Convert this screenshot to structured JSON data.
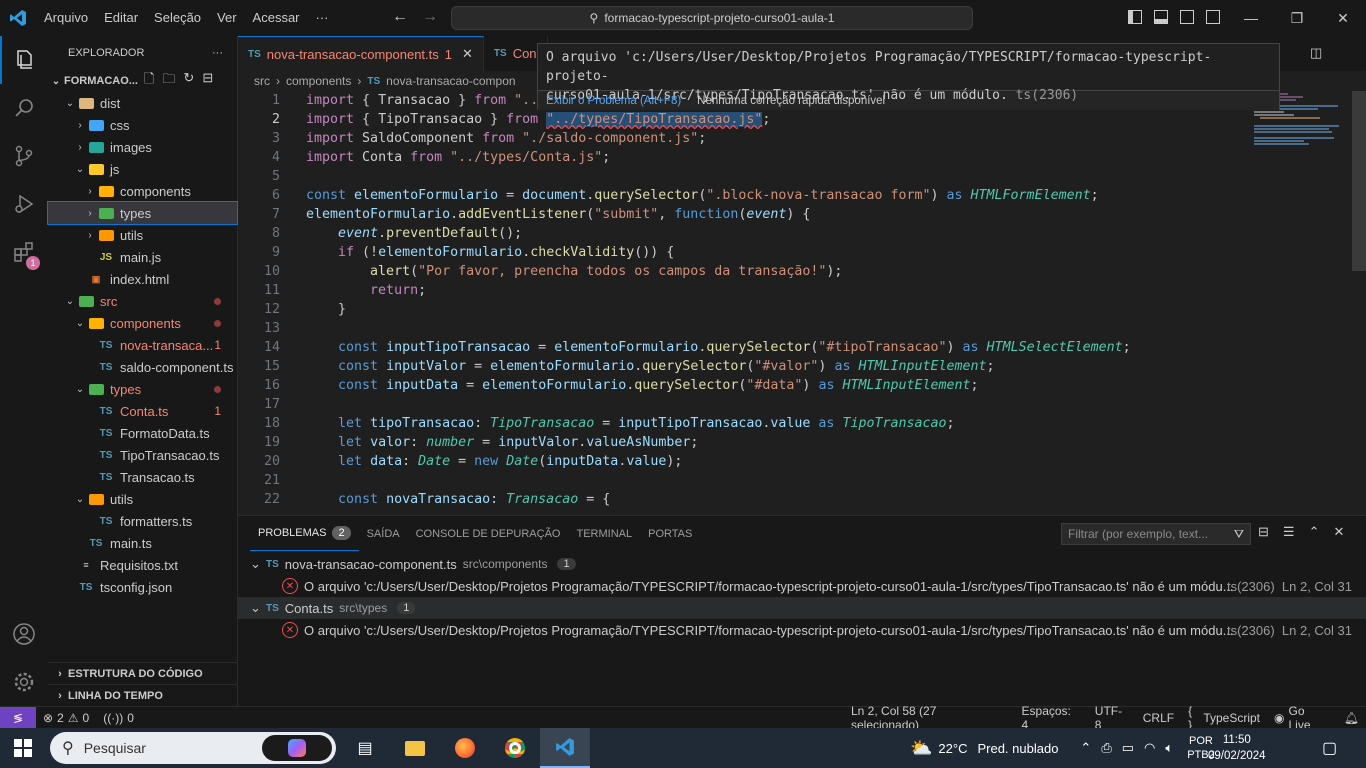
{
  "titlebar": {
    "menu": [
      "Arquivo",
      "Editar",
      "Seleção",
      "Ver",
      "Acessar",
      "···"
    ],
    "search_text": "formacao-typescript-projeto-curso01-aula-1"
  },
  "sidebar": {
    "header": "EXPLORADOR",
    "root": "FORMACAO...",
    "items": [
      {
        "label": "dist"
      },
      {
        "label": "css"
      },
      {
        "label": "images"
      },
      {
        "label": "js"
      },
      {
        "label": "components"
      },
      {
        "label": "types"
      },
      {
        "label": "utils"
      },
      {
        "label": "main.js"
      },
      {
        "label": "index.html"
      },
      {
        "label": "src"
      },
      {
        "label": "components"
      },
      {
        "label": "nova-transaca...",
        "count": "1"
      },
      {
        "label": "saldo-component.ts"
      },
      {
        "label": "types"
      },
      {
        "label": "Conta.ts",
        "count": "1"
      },
      {
        "label": "FormatoData.ts"
      },
      {
        "label": "TipoTransacao.ts"
      },
      {
        "label": "Transacao.ts"
      },
      {
        "label": "utils"
      },
      {
        "label": "formatters.ts"
      },
      {
        "label": "main.ts"
      },
      {
        "label": "Requisitos.txt"
      },
      {
        "label": "tsconfig.json"
      }
    ],
    "outline": "ESTRUTURA DO CÓDIGO",
    "timeline": "LINHA DO TEMPO"
  },
  "tabs": {
    "active": {
      "icon": "TS",
      "label": "nova-transacao-component.ts",
      "count": "1"
    },
    "second": {
      "icon": "TS",
      "label": "Con"
    }
  },
  "breadcrumb": [
    "src",
    "components",
    "nova-transacao-compon"
  ],
  "hover": {
    "message_line1": "O arquivo 'c:/Users/User/Desktop/Projetos Programação/TYPESCRIPT/formacao-typescript-projeto-",
    "message_line2": "curso01-aula-1/src/types/TipoTransacao.ts' não é um módulo.",
    "code": "ts(2306)",
    "action_link": "Exibir o Problema (Alt+F8)",
    "action_text": "Nenhuma correção rápida disponível"
  },
  "code": {
    "line_numbers": [
      "1",
      "2",
      "3",
      "4",
      "5",
      "6",
      "7",
      "8",
      "9",
      "10",
      "11",
      "12",
      "13",
      "14",
      "15",
      "16",
      "17",
      "18",
      "19",
      "20",
      "21",
      "22"
    ],
    "l1_kw": "import",
    "l1_a": " { Transacao } ",
    "l1_from": "from",
    "l1_str": " \"../",
    "l2_kw": "import",
    "l2_a": " { TipoTransacao } ",
    "l2_from": "from",
    "l2_str": "\"../types/TipoTransacao.js\"",
    "l2_end": ";",
    "l3_kw": "import",
    "l3_a": " SaldoComponent ",
    "l3_from": "from",
    "l3_str": " \"./saldo-component.js\"",
    "l3_end": ";",
    "l4_kw": "import",
    "l4_a": " Conta ",
    "l4_from": "from",
    "l4_str": " \"../types/Conta.js\"",
    "l4_end": ";",
    "l6_const": "const",
    "l6_var": " elementoFormulario",
    "l6_eq": " = ",
    "l6_doc": "document",
    "l6_dot": ".",
    "l6_fn": "querySelector",
    "l6_p": "(",
    "l6_str": "\".block-nova-transacao form\"",
    "l6_p2": ") ",
    "l6_as": "as",
    "l6_typ": " HTMLFormElement",
    "l6_end": ";",
    "l7_var": "elementoFormulario",
    "l7_dot": ".",
    "l7_fn": "addEventListener",
    "l7_p": "(",
    "l7_str": "\"submit\"",
    "l7_c": ", ",
    "l7_func": "function",
    "l7_p2": "(",
    "l7_ev": "event",
    "l7_p3": ") {",
    "l8_ev": "event",
    "l8_dot": ".",
    "l8_fn": "preventDefault",
    "l8_end": "();",
    "l9_if": "if",
    "l9_p": " (!",
    "l9_var": "elementoFormulario",
    "l9_dot": ".",
    "l9_fn": "checkValidity",
    "l9_end": "()) {",
    "l10_fn": "alert",
    "l10_p": "(",
    "l10_str": "\"Por favor, preencha todos os campos da transação!\"",
    "l10_end": ");",
    "l11_ret": "return",
    "l11_end": ";",
    "l12": "}",
    "l14_const": "const",
    "l14_var": " inputTipoTransacao",
    "l14_eq": " = ",
    "l14_v2": "elementoFormulario",
    "l14_dot": ".",
    "l14_fn": "querySelector",
    "l14_p": "(",
    "l14_str": "\"#tipoTransacao\"",
    "l14_p2": ") ",
    "l14_as": "as",
    "l14_typ": " HTMLSelectElement",
    "l14_end": ";",
    "l15_const": "const",
    "l15_var": " inputValor",
    "l15_eq": " = ",
    "l15_v2": "elementoFormulario",
    "l15_dot": ".",
    "l15_fn": "querySelector",
    "l15_p": "(",
    "l15_str": "\"#valor\"",
    "l15_p2": ") ",
    "l15_as": "as",
    "l15_typ": " HTMLInputElement",
    "l15_end": ";",
    "l16_const": "const",
    "l16_var": " inputData",
    "l16_eq": " = ",
    "l16_v2": "elementoFormulario",
    "l16_dot": ".",
    "l16_fn": "querySelector",
    "l16_p": "(",
    "l16_str": "\"#data\"",
    "l16_p2": ") ",
    "l16_as": "as",
    "l16_typ": " HTMLInputElement",
    "l16_end": ";",
    "l18_let": "let",
    "l18_var": " tipoTransacao",
    "l18_c": ": ",
    "l18_typ": "TipoTransacao",
    "l18_eq": " = ",
    "l18_v2": "inputTipoTransacao",
    "l18_dot": ".",
    "l18_v3": "value",
    "l18_as": " as",
    "l18_typ2": " TipoTransacao",
    "l18_end": ";",
    "l19_let": "let",
    "l19_var": " valor",
    "l19_c": ": ",
    "l19_typ": "number",
    "l19_eq": " = ",
    "l19_v2": "inputValor",
    "l19_dot": ".",
    "l19_v3": "valueAsNumber",
    "l19_end": ";",
    "l20_let": "let",
    "l20_var": " data",
    "l20_c": ": ",
    "l20_typ": "Date",
    "l20_eq": " = ",
    "l20_new": "new",
    "l20_typ2": " Date",
    "l20_p": "(",
    "l20_v2": "inputData",
    "l20_dot": ".",
    "l20_v3": "value",
    "l20_end": ");",
    "l22_const": "const",
    "l22_var": " novaTransacao",
    "l22_c": ": ",
    "l22_typ": "Transacao",
    "l22_end": " = {"
  },
  "panel": {
    "tabs": [
      "PROBLEMAS",
      "SAÍDA",
      "CONSOLE DE DEPURAÇÃO",
      "TERMINAL",
      "PORTAS"
    ],
    "problems_count": "2",
    "filter_placeholder": "Filtrar (por exemplo, text...",
    "groups": [
      {
        "icon": "TS",
        "file": "nova-transacao-component.ts",
        "path": "src\\components",
        "count": "1",
        "error": "O arquivo 'c:/Users/User/Desktop/Projetos Programação/TYPESCRIPT/formacao-typescript-projeto-curso01-aula-1/src/types/TipoTransacao.ts' não é um módu...",
        "code": "ts(2306)",
        "pos": "Ln 2, Col 31"
      },
      {
        "icon": "TS",
        "file": "Conta.ts",
        "path": "src\\types",
        "count": "1",
        "error": "O arquivo 'c:/Users/User/Desktop/Projetos Programação/TYPESCRIPT/formacao-typescript-projeto-curso01-aula-1/src/types/TipoTransacao.ts' não é um módu...",
        "code": "ts(2306)",
        "pos": "Ln 2, Col 31"
      }
    ]
  },
  "statusbar": {
    "errors": "2",
    "warnings": "0",
    "ports": "0",
    "position": "Ln 2, Col 58 (27 selecionado)",
    "spaces": "Espaços: 4",
    "encoding": "UTF-8",
    "eol": "CRLF",
    "language": "TypeScript",
    "golive": "Go Live"
  },
  "taskbar": {
    "search": "Pesquisar",
    "weather_temp": "22°C",
    "weather_text": "Pred. nublado",
    "lang1": "POR",
    "lang2": "PTB2",
    "time": "11:50",
    "date": "09/02/2024"
  }
}
